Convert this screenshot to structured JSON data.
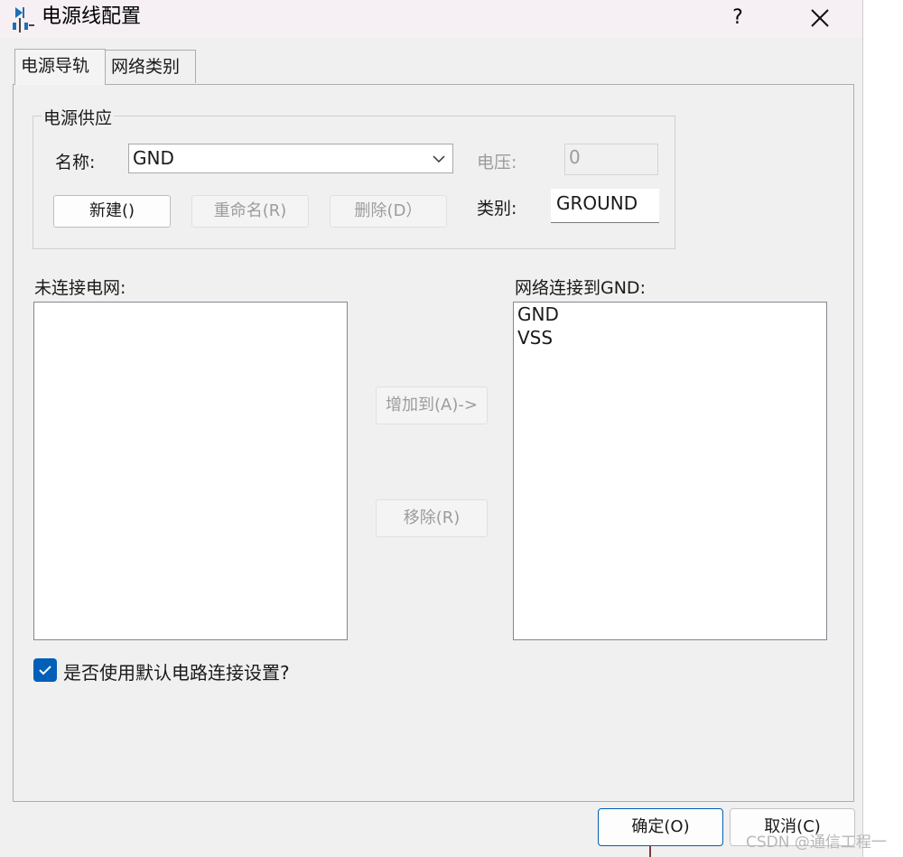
{
  "window": {
    "title": "电源线配置",
    "help_label": "?"
  },
  "tabs": [
    {
      "label": "电源导轨",
      "active": true
    },
    {
      "label": "网络类别",
      "active": false
    }
  ],
  "power_supply": {
    "group_title": "电源供应",
    "name_label": "名称:",
    "name_value": "GND",
    "voltage_label": "电压:",
    "voltage_value": "0",
    "type_label": "类别:",
    "type_value": "GROUND",
    "new_button": "新建()",
    "rename_button": "重命名(R)",
    "delete_button": "删除(D）"
  },
  "unconnected": {
    "label": "未连接电网:",
    "items": []
  },
  "connected": {
    "label": "网络连接到GND:",
    "items": [
      "GND",
      "VSS"
    ]
  },
  "middle_buttons": {
    "add": "增加到(A)->",
    "remove": "移除(R)"
  },
  "default_checkbox": {
    "label": "是否使用默认电路连接设置?",
    "checked": true
  },
  "footer": {
    "ok": "确定(O)",
    "cancel": "取消(C)"
  },
  "watermark": "CSDN @通信工程一",
  "colors": {
    "accent": "#005fb8",
    "titlebar": "#f6eff3",
    "dialog_bg": "#f0f0f0"
  }
}
